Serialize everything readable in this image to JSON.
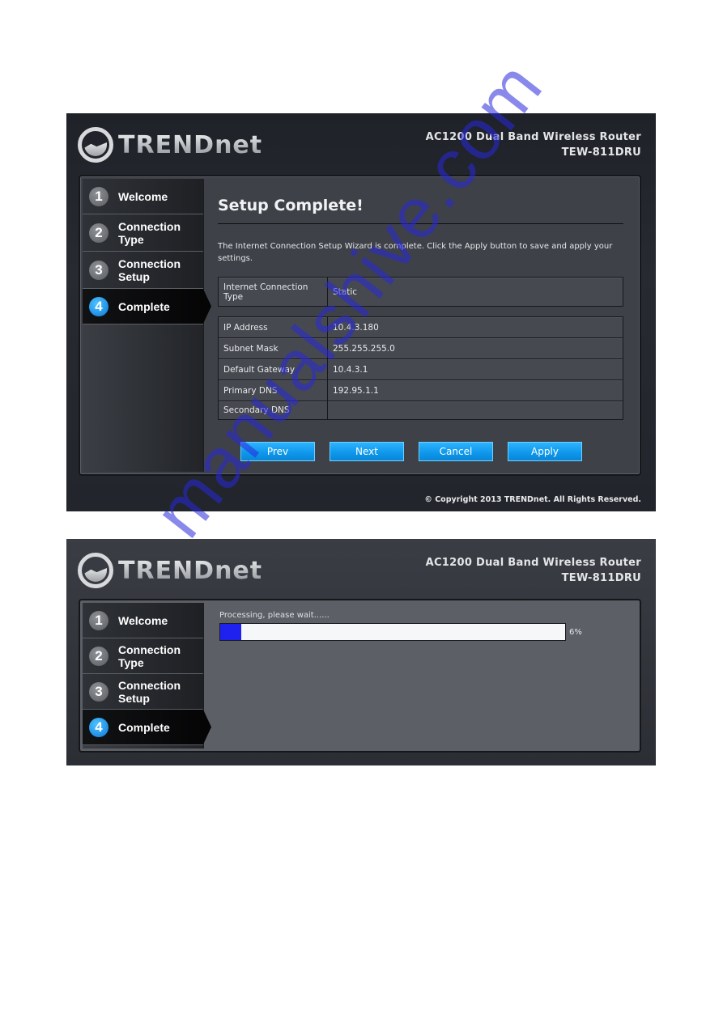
{
  "screenshots": [
    {
      "header": {
        "brand": "TRENDnet",
        "product_line": "AC1200 Dual Band Wireless Router",
        "model": "TEW-811DRU"
      },
      "steps": [
        {
          "num": "1",
          "label": "Welcome",
          "active": false
        },
        {
          "num": "2",
          "label": "Connection Type",
          "active": false
        },
        {
          "num": "3",
          "label": "Connection Setup",
          "active": false
        },
        {
          "num": "4",
          "label": "Complete",
          "active": true
        }
      ],
      "content": {
        "title": "Setup Complete!",
        "intro": "The Internet Connection Setup Wizard is complete. Click the Apply button to save and apply your settings.",
        "connection_type": {
          "label": "Internet Connection Type",
          "value": "Static"
        },
        "settings": [
          {
            "label": "IP Address",
            "value": "10.4.3.180"
          },
          {
            "label": "Subnet Mask",
            "value": "255.255.255.0"
          },
          {
            "label": "Default Gateway",
            "value": "10.4.3.1"
          },
          {
            "label": "Primary DNS",
            "value": "192.95.1.1"
          },
          {
            "label": "Secondary DNS",
            "value": ""
          }
        ],
        "buttons": {
          "prev": "Prev",
          "next": "Next",
          "cancel": "Cancel",
          "apply": "Apply"
        }
      },
      "footer": {
        "copyright": "© Copyright 2013 TRENDnet. All Rights Reserved."
      }
    },
    {
      "header": {
        "brand": "TRENDnet",
        "product_line": "AC1200 Dual Band Wireless Router",
        "model": "TEW-811DRU"
      },
      "steps": [
        {
          "num": "1",
          "label": "Welcome",
          "active": false
        },
        {
          "num": "2",
          "label": "Connection Type",
          "active": false
        },
        {
          "num": "3",
          "label": "Connection Setup",
          "active": false
        },
        {
          "num": "4",
          "label": "Complete",
          "active": true
        }
      ],
      "progress": {
        "label": "Processing, please wait......",
        "percent": 6,
        "percent_text": "6%",
        "fill_color": "#1f22ee"
      }
    }
  ],
  "colors": {
    "accent_blue": "#0d96ea",
    "active_step": "#0a78d8"
  },
  "watermark": "manualshive.com"
}
